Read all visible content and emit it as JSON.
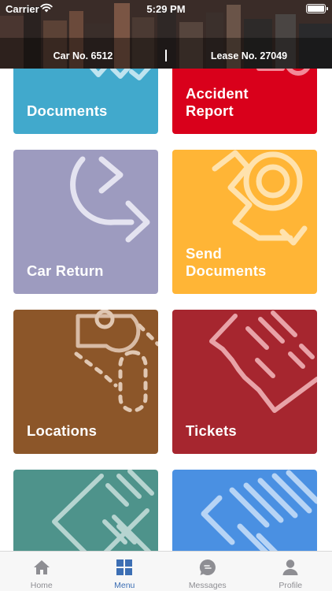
{
  "status_bar": {
    "carrier": "Carrier",
    "time": "5:29 PM",
    "icons": [
      "wifi-icon",
      "battery-icon"
    ]
  },
  "info_bar": {
    "car": "Car No. 6512",
    "lease": "Lease No. 27049"
  },
  "tiles": [
    {
      "label": "Documents",
      "color": "#41a9cc",
      "icon": "documents-check-icon"
    },
    {
      "label": "Accident\nReport",
      "color": "#d9001b",
      "icon": "accident-pin-icon"
    },
    {
      "label": "Car Return",
      "color": "#9d9bbf",
      "icon": "return-arrow-icon"
    },
    {
      "label": "Send\nDocuments",
      "color": "#ffb536",
      "icon": "send-documents-icon"
    },
    {
      "label": "Locations",
      "color": "#8c5629",
      "icon": "location-route-icon"
    },
    {
      "label": "Tickets",
      "color": "#a6262f",
      "icon": "ticket-icon"
    },
    {
      "label": "",
      "color": "#4e938b",
      "icon": "pencil-document-icon"
    },
    {
      "label": "",
      "color": "#4a90e2",
      "icon": "stripes-icon"
    }
  ],
  "tab_bar": {
    "active": "Menu",
    "items": [
      {
        "label": "Home",
        "icon": "home-icon"
      },
      {
        "label": "Menu",
        "icon": "grid-icon"
      },
      {
        "label": "Messages",
        "icon": "chat-bubble-icon"
      },
      {
        "label": "Profile",
        "icon": "person-icon"
      }
    ],
    "active_color": "#3d6fb4",
    "inactive_color": "#8e8e93"
  }
}
